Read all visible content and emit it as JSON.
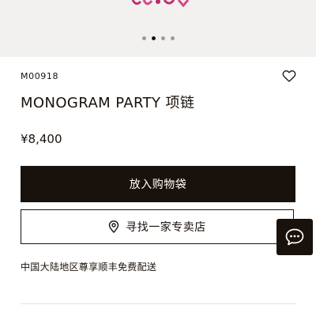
{
  "product": {
    "sku": "M00918",
    "name": "MONOGRAM PARTY 项链",
    "price": "¥8,400"
  },
  "carousel": {
    "slide_count": 4,
    "active_index": 1
  },
  "actions": {
    "add_to_cart_label": "放入购物袋",
    "find_store_label": "寻找一家专卖店"
  },
  "shipping": {
    "note": "中国大陆地区尊享顺丰免费配送"
  },
  "icons": {
    "wishlist": "heart-icon",
    "store": "location-pin-icon",
    "chat": "chat-bubble-icon"
  },
  "colors": {
    "primary": "#19110b",
    "hero_background": "#f2f1ef"
  }
}
